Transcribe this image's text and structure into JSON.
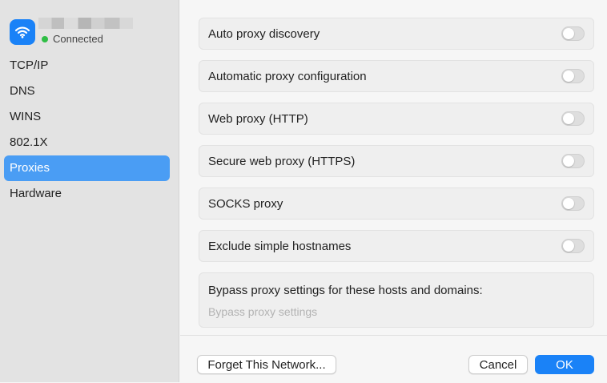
{
  "network": {
    "status": "Connected",
    "status_color": "#2fbe45",
    "icon": "wifi-icon"
  },
  "sidebar": {
    "items": [
      {
        "label": "TCP/IP"
      },
      {
        "label": "DNS"
      },
      {
        "label": "WINS"
      },
      {
        "label": "802.1X"
      },
      {
        "label": "Proxies",
        "selected": true
      },
      {
        "label": "Hardware"
      }
    ],
    "selected_color": "#4a9df4"
  },
  "proxies": {
    "settings": [
      {
        "label": "Auto proxy discovery",
        "enabled": false
      },
      {
        "label": "Automatic proxy configuration",
        "enabled": false
      },
      {
        "label": "Web proxy (HTTP)",
        "enabled": false
      },
      {
        "label": "Secure web proxy (HTTPS)",
        "enabled": false
      },
      {
        "label": "SOCKS proxy",
        "enabled": false
      },
      {
        "label": "Exclude simple hostnames",
        "enabled": false
      }
    ],
    "bypass": {
      "label": "Bypass proxy settings for these hosts and domains:",
      "placeholder": "Bypass proxy settings",
      "value": ""
    }
  },
  "footer": {
    "forget_label": "Forget This Network...",
    "cancel_label": "Cancel",
    "ok_label": "OK",
    "accent": "#1a82f7"
  }
}
